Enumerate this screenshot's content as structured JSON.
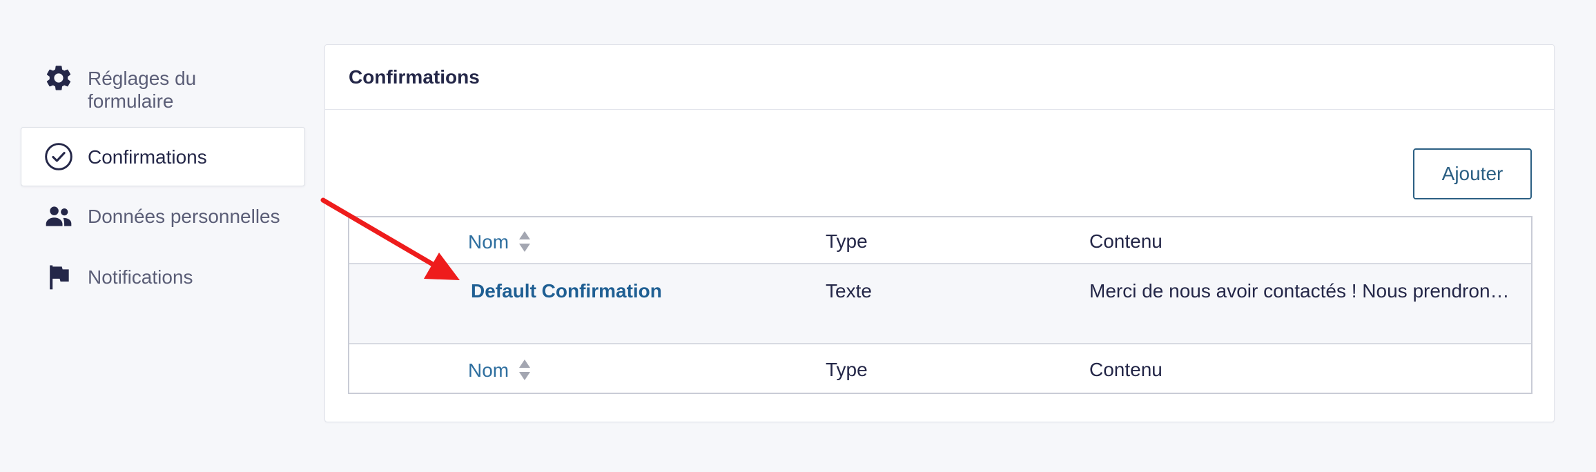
{
  "sidebar": {
    "items": [
      {
        "label": "Réglages du formulaire",
        "icon": "gear-icon",
        "active": false
      },
      {
        "label": "Confirmations",
        "icon": "check-circle-icon",
        "active": true
      },
      {
        "label": "Données personnelles",
        "icon": "users-icon",
        "active": false
      },
      {
        "label": "Notifications",
        "icon": "flag-icon",
        "active": false
      }
    ]
  },
  "panel": {
    "title": "Confirmations",
    "add_label": "Ajouter"
  },
  "table": {
    "columns": [
      "Nom",
      "Type",
      "Contenu"
    ],
    "rows": [
      {
        "name": "Default Confirmation",
        "type": "Texte",
        "content": "Merci de nous avoir contactés ! Nous prendrons …"
      }
    ]
  },
  "colors": {
    "accent": "#2b5f83",
    "link": "#1f5f93",
    "annotation_arrow": "#ee1c1c"
  }
}
